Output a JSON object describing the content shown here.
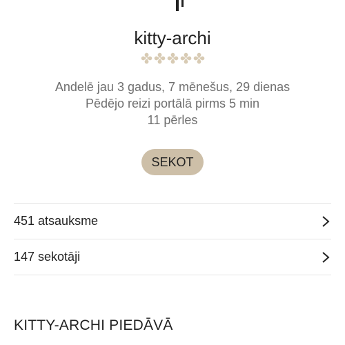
{
  "profile": {
    "username": "kitty-archi",
    "rating_icon": "flower-star-icon",
    "rating_max": 5,
    "rating_value": 0,
    "member_since": "Andelē jau 3 gadus, 7 mēnešus, 29 dienas",
    "last_seen": "Pēdējo reizi portālā pirms 5 min",
    "pearls": "11 pērles"
  },
  "actions": {
    "follow_label": "SEKOT"
  },
  "stats": {
    "reviews_label": "451 atsauksme",
    "followers_label": "147 sekotāji"
  },
  "section": {
    "offers_title": "KITTY-ARCHI PIEDĀVĀ"
  },
  "colors": {
    "accent_button": "#cdbfa8",
    "rating_icon": "#d8cbb4",
    "muted_text": "#6f6f6f",
    "divider": "#e4e4e4"
  }
}
